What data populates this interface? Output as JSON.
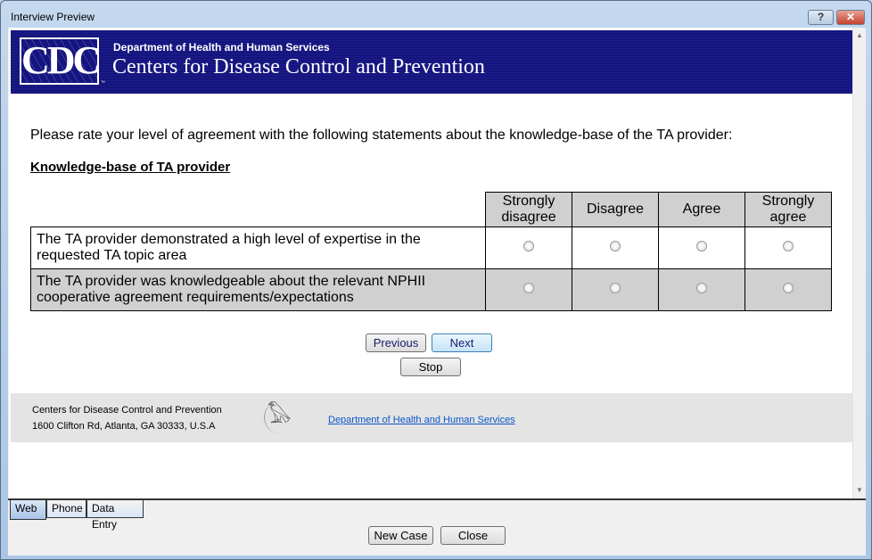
{
  "window": {
    "title": "Interview Preview",
    "help": "?",
    "close": "✕"
  },
  "banner": {
    "logo": "CDC",
    "tm": "™",
    "dept": "Department of Health and Human Services",
    "name": "Centers for Disease Control and Prevention"
  },
  "question": "Please rate your level of agreement with the following statements about the knowledge-base of the TA provider:",
  "heading": "Knowledge-base of TA provider",
  "columns": [
    "Strongly disagree",
    "Disagree",
    "Agree",
    "Strongly agree"
  ],
  "rows": [
    "The TA provider demonstrated a high level of expertise in the requested TA topic area",
    "The TA provider was knowledgeable about the relevant NPHII cooperative agreement requirements/expectations"
  ],
  "buttons": {
    "previous": "Previous",
    "next": "Next",
    "stop": "Stop"
  },
  "footer": {
    "org": "Centers for Disease Control and Prevention",
    "address": "1600 Clifton Rd, Atlanta, GA 30333, U.S.A",
    "link": "Department of Health and Human Services"
  },
  "tabs": [
    "Web",
    "Phone",
    "Data Entry"
  ],
  "bottom": {
    "new_case": "New Case",
    "close": "Close"
  }
}
